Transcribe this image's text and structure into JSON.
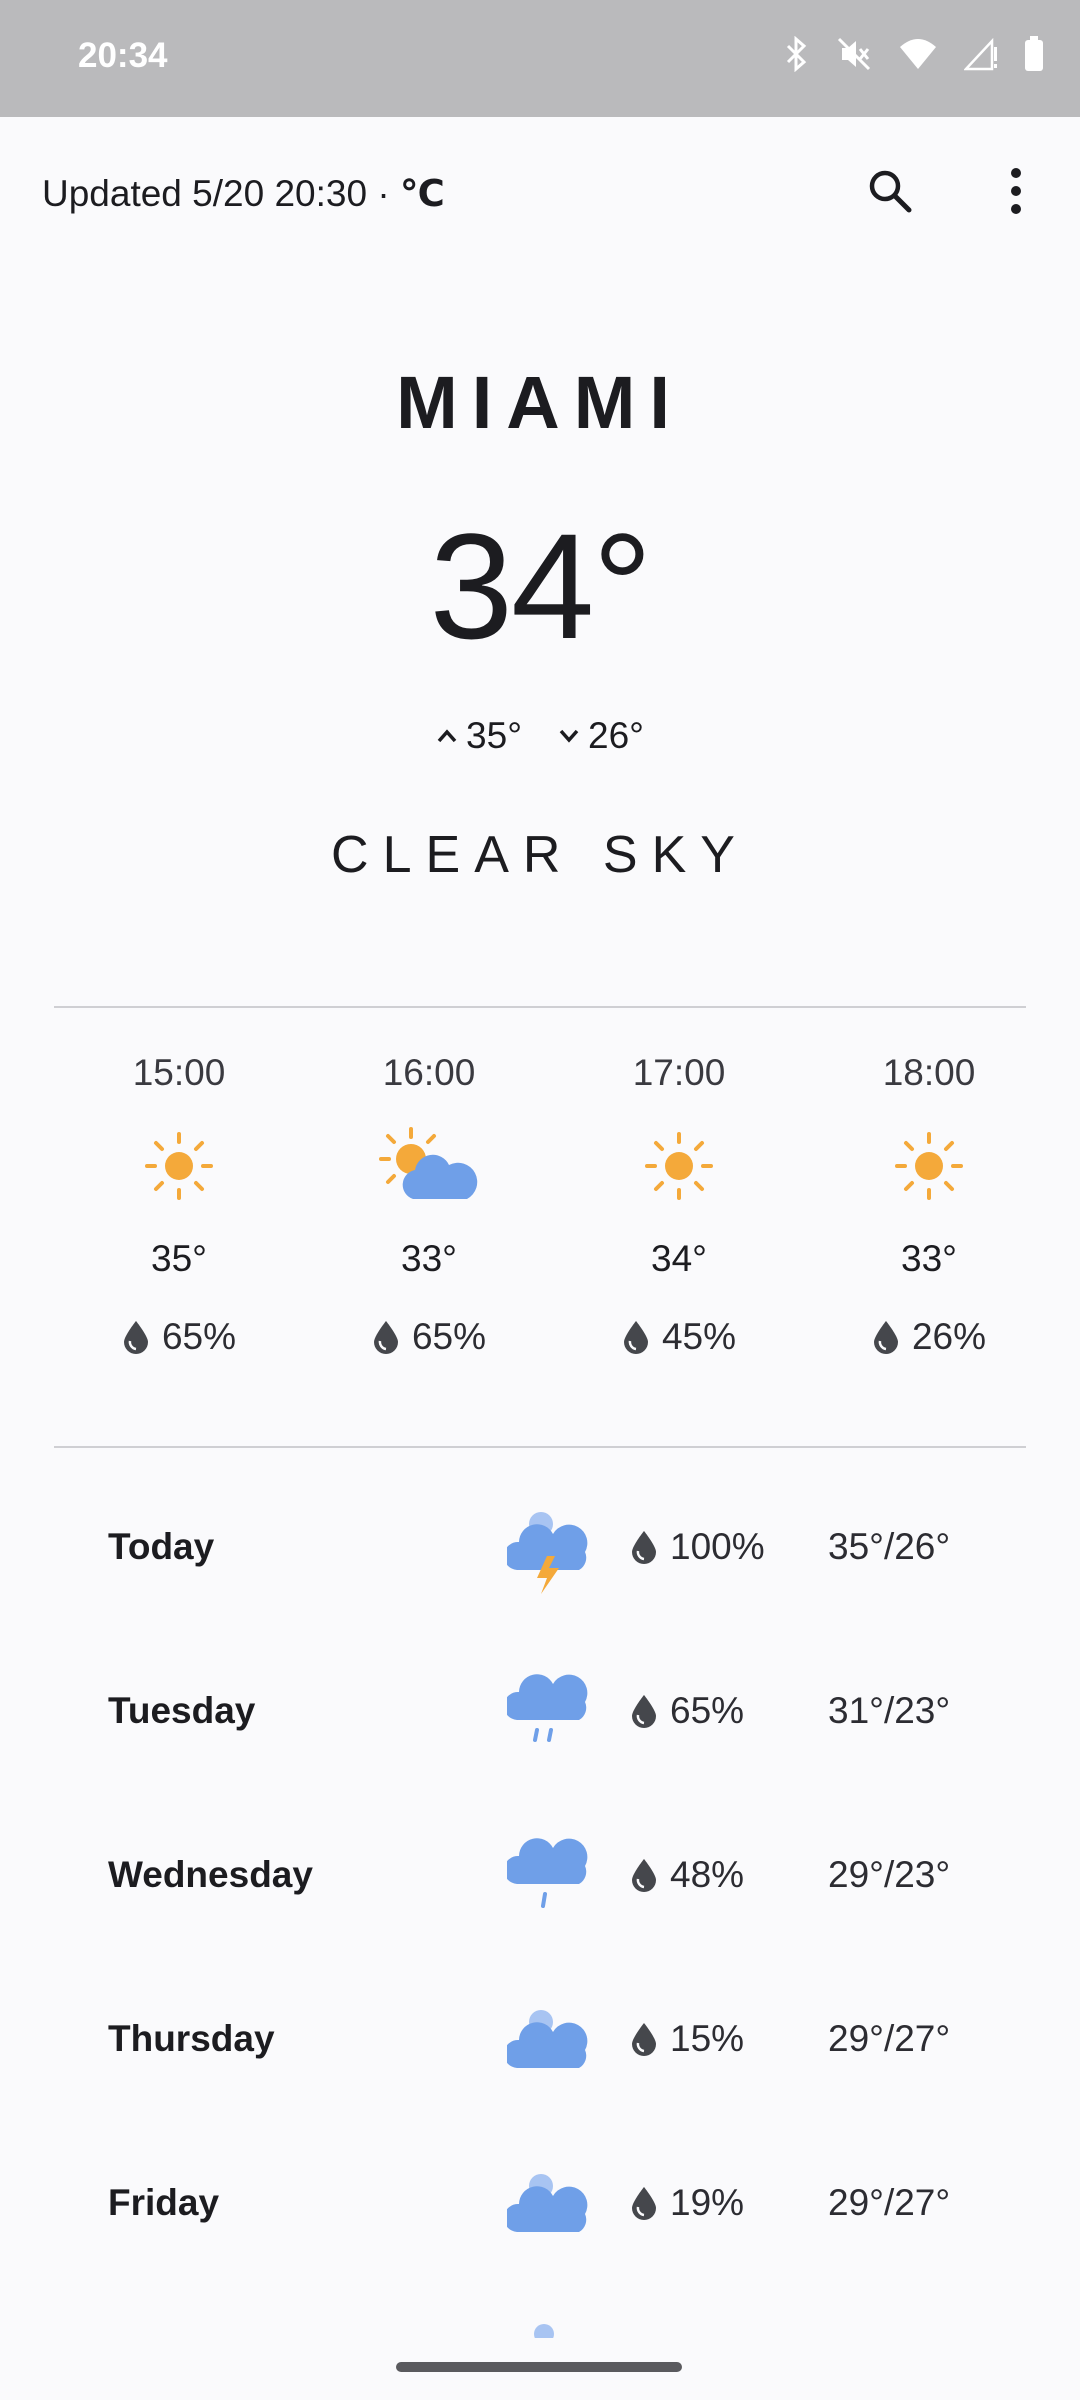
{
  "status": {
    "time": "20:34"
  },
  "header": {
    "updated": "Updated 5/20 20:30 · ",
    "unit": "℃"
  },
  "current": {
    "city": "MIAMI",
    "temp": "34°",
    "high": "35°",
    "low": "26°",
    "condition": "CLEAR SKY"
  },
  "hourly": [
    {
      "time": "15:00",
      "icon": "sun-icon",
      "temp": "35°",
      "precip": "65%"
    },
    {
      "time": "16:00",
      "icon": "partly-cloudy-icon",
      "temp": "33°",
      "precip": "65%"
    },
    {
      "time": "17:00",
      "icon": "sun-icon",
      "temp": "34°",
      "precip": "45%"
    },
    {
      "time": "18:00",
      "icon": "sun-icon",
      "temp": "33°",
      "precip": "26%"
    }
  ],
  "daily": [
    {
      "day": "Today",
      "icon": "thunderstorm-icon",
      "precip": "100%",
      "temps": "35°/26°"
    },
    {
      "day": "Tuesday",
      "icon": "rain-icon",
      "precip": "65%",
      "temps": "31°/23°"
    },
    {
      "day": "Wednesday",
      "icon": "light-rain-icon",
      "precip": "48%",
      "temps": "29°/23°"
    },
    {
      "day": "Thursday",
      "icon": "cloudy-icon",
      "precip": "15%",
      "temps": "29°/27°"
    },
    {
      "day": "Friday",
      "icon": "cloudy-icon",
      "precip": "19%",
      "temps": "29°/27°"
    }
  ],
  "colors": {
    "sun": "#f4a93a",
    "cloud": "#6f9fe8",
    "cloud_light": "#a8c4f2",
    "drop": "#45474c"
  }
}
